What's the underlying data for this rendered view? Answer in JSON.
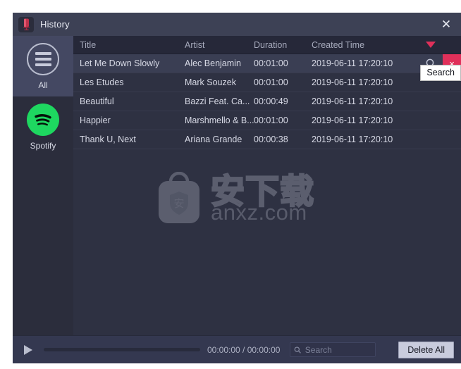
{
  "window": {
    "title": "History",
    "app_icon": "recorder-icon",
    "close_label": "✕"
  },
  "sidebar": {
    "items": [
      {
        "label": "All",
        "icon": "hamburger-circle-icon",
        "active": true
      },
      {
        "label": "Spotify",
        "icon": "spotify-icon",
        "active": false
      }
    ]
  },
  "table": {
    "columns": [
      "Title",
      "Artist",
      "Duration",
      "Created Time"
    ],
    "sort_indicator": "sort-descending-caret",
    "sort_color": "#e0305a",
    "rows": [
      {
        "title": "Let Me Down Slowly",
        "artist": "Alec Benjamin",
        "duration": "00:01:00",
        "created": "2019-06-11 17:20:10",
        "hovered": true
      },
      {
        "title": "Les Etudes",
        "artist": "Mark Souzek",
        "duration": "00:01:00",
        "created": "2019-06-11 17:20:10",
        "hovered": false
      },
      {
        "title": "Beautiful",
        "artist": "Bazzi Feat. Ca...",
        "duration": "00:00:49",
        "created": "2019-06-11 17:20:10",
        "hovered": false
      },
      {
        "title": "Happier",
        "artist": "Marshmello & B...",
        "duration": "00:01:00",
        "created": "2019-06-11 17:20:10",
        "hovered": false
      },
      {
        "title": "Thank U, Next",
        "artist": "Ariana Grande",
        "duration": "00:00:38",
        "created": "2019-06-11 17:20:10",
        "hovered": false
      }
    ],
    "row_actions": {
      "search_icon": "magnifier-icon",
      "delete_label": "×"
    }
  },
  "tooltip": {
    "text": "Search"
  },
  "watermark": {
    "cn_text": "安下载",
    "domain_text": "anxz.com",
    "badge_char": "安"
  },
  "bottombar": {
    "play_icon": "play-icon",
    "time_display": "00:00:00 / 00:00:00",
    "search_placeholder": "Search",
    "search_value": "",
    "delete_all_label": "Delete All"
  }
}
